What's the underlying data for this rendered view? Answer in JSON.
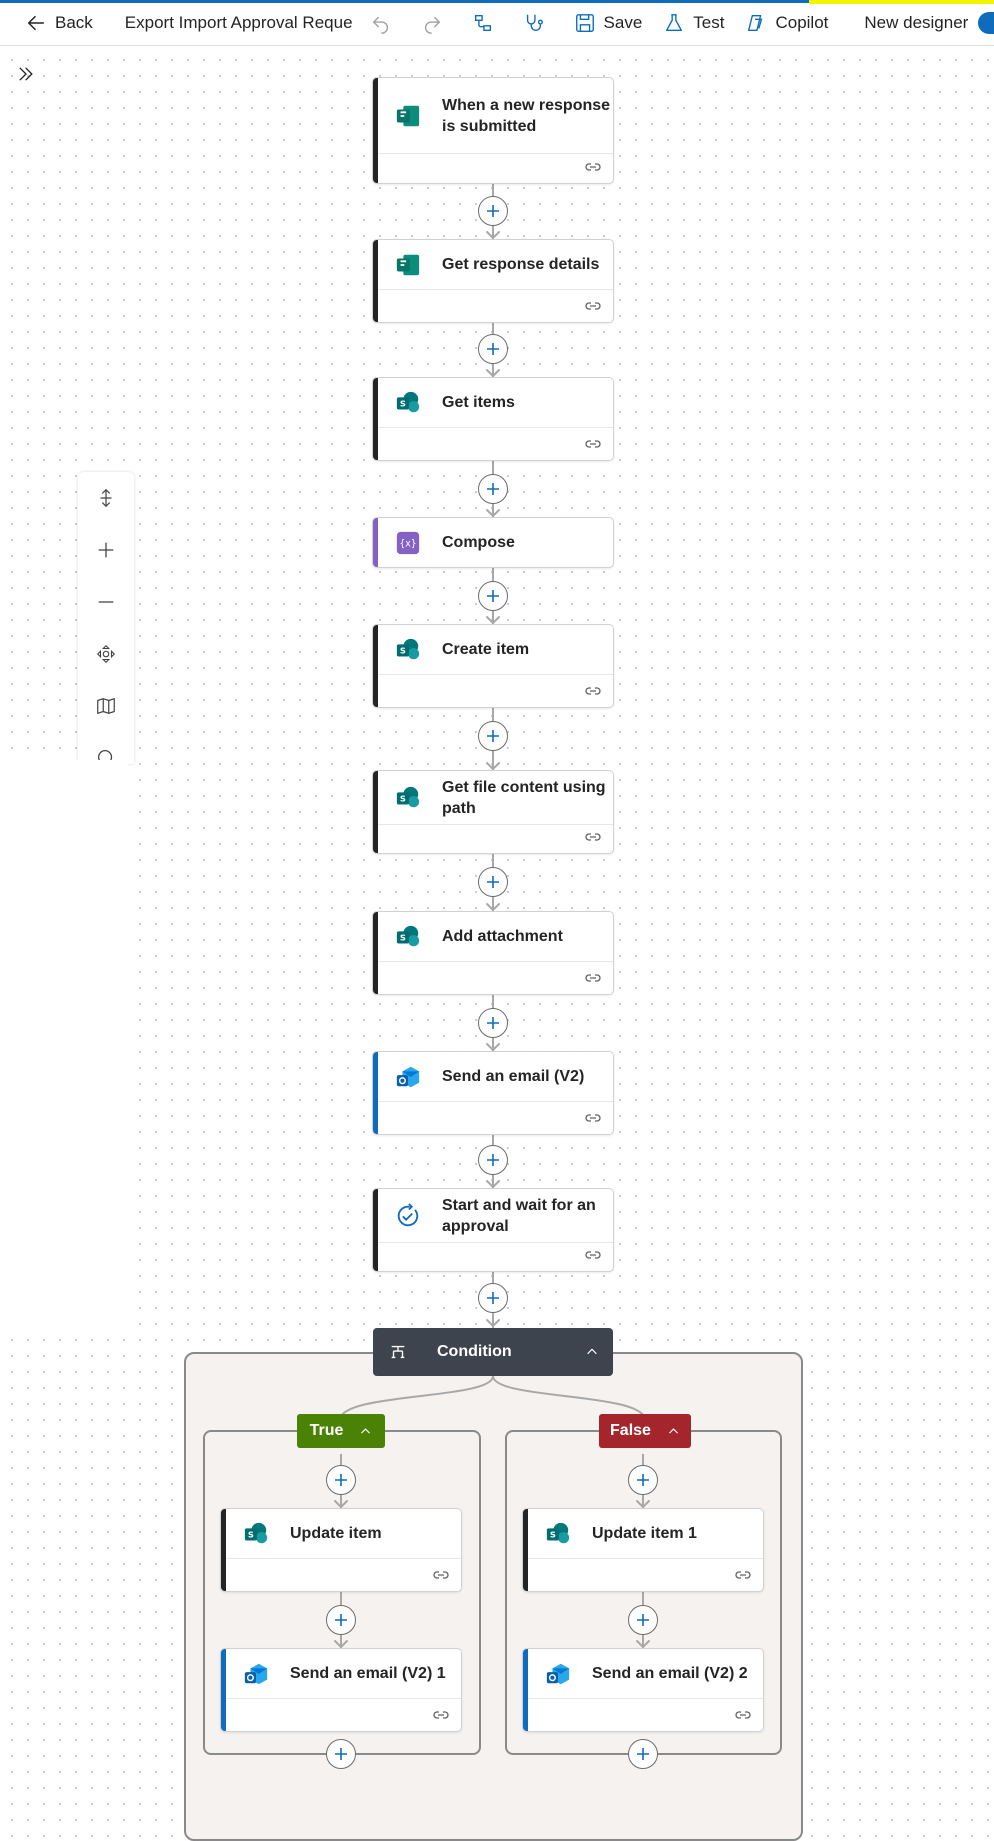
{
  "toolbar": {
    "back_label": "Back",
    "flow_name": "Export Import Approval Reque",
    "save_label": "Save",
    "test_label": "Test",
    "copilot_label": "Copilot",
    "new_designer_label": "New designer"
  },
  "colors": {
    "forms": "#077568",
    "sharepoint": "#03787c",
    "compose": "#8661c5",
    "outlook_bar": "#0f6cbd",
    "true_branch": "#498205",
    "false_branch": "#a4262c",
    "condition_header": "#3d444d"
  },
  "nodes": {
    "n1": {
      "title": "When a new response is submitted",
      "icon": "forms-icon"
    },
    "n2": {
      "title": "Get response details",
      "icon": "forms-icon"
    },
    "n3": {
      "title": "Get items",
      "icon": "sharepoint-icon"
    },
    "n4": {
      "title": "Compose",
      "icon": "compose-icon"
    },
    "n5": {
      "title": "Create item",
      "icon": "sharepoint-icon"
    },
    "n6": {
      "title": "Get file content using path",
      "icon": "sharepoint-icon"
    },
    "n7": {
      "title": "Add attachment",
      "icon": "sharepoint-icon"
    },
    "n8": {
      "title": "Send an email (V2)",
      "icon": "outlook-icon"
    },
    "n9": {
      "title": "Start and wait for an approval",
      "icon": "approval-icon"
    }
  },
  "condition": {
    "title": "Condition",
    "true_label": "True",
    "false_label": "False",
    "true_branch": [
      {
        "title": "Update item",
        "icon": "sharepoint-icon"
      },
      {
        "title": "Send an email (V2) 1",
        "icon": "outlook-icon"
      }
    ],
    "false_branch": [
      {
        "title": "Update item 1",
        "icon": "sharepoint-icon"
      },
      {
        "title": "Send an email (V2) 2",
        "icon": "outlook-icon"
      }
    ]
  }
}
